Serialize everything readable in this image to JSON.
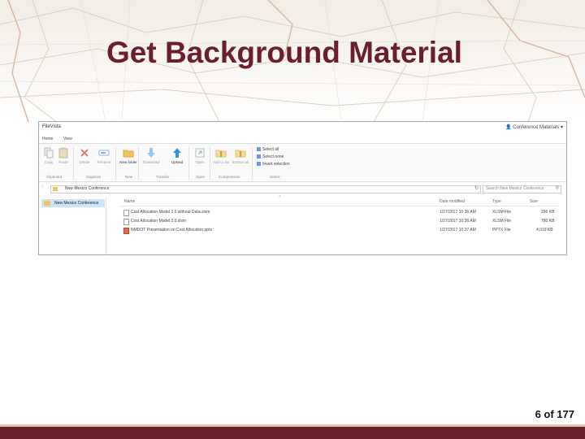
{
  "slide": {
    "title": "Get Background Material",
    "page_number": "6 of 177",
    "accent_color": "#6b1f2b"
  },
  "window": {
    "app_title": "FileVista",
    "user_menu": "Conference Materials",
    "tabs": [
      "Home",
      "View"
    ],
    "ribbon": {
      "buttons": [
        {
          "label": "Copy",
          "icon": "copy-icon"
        },
        {
          "label": "Paste",
          "icon": "paste-icon"
        },
        {
          "label": "Delete",
          "icon": "delete-icon"
        },
        {
          "label": "Rename",
          "icon": "rename-icon"
        },
        {
          "label": "New folder",
          "icon": "new-folder-icon"
        },
        {
          "label": "Download",
          "icon": "download-icon"
        },
        {
          "label": "Upload",
          "icon": "upload-icon"
        },
        {
          "label": "Open",
          "icon": "open-icon"
        },
        {
          "label": "Add to zip",
          "icon": "zip-add-icon"
        },
        {
          "label": "Extract all",
          "icon": "zip-extract-icon"
        }
      ],
      "groups": [
        "Clipboard",
        "Organize",
        "New",
        "Transfer",
        "Open",
        "Compression",
        "Select"
      ],
      "select_options": [
        "Select all",
        "Select none",
        "Invert selection"
      ]
    },
    "address_path": "New Mexico Conference",
    "search_placeholder": "Search New Mexico Conference",
    "nav_tree": {
      "selected_folder": "New Mexico Conference"
    },
    "file_list": {
      "columns": [
        "Name",
        "Date modified",
        "Type",
        "Size"
      ],
      "rows": [
        {
          "name": "Cost Allocation Model 2.0 without Data.xlsm",
          "date": "1/27/2017 10:36 AM",
          "type": "XLSM File",
          "size": "296 KB",
          "icon": "excel-file-icon"
        },
        {
          "name": "Cost Allocation Model 2.0.xlsm",
          "date": "1/27/2017 10:36 AM",
          "type": "XLSM File",
          "size": "780 KB",
          "icon": "excel-file-icon"
        },
        {
          "name": "NMDOT Presentation on Cost Allocation.pptx",
          "date": "1/27/2017 10:37 AM",
          "type": "PPTX File",
          "size": "4,019 KB",
          "icon": "powerpoint-file-icon"
        }
      ]
    }
  }
}
